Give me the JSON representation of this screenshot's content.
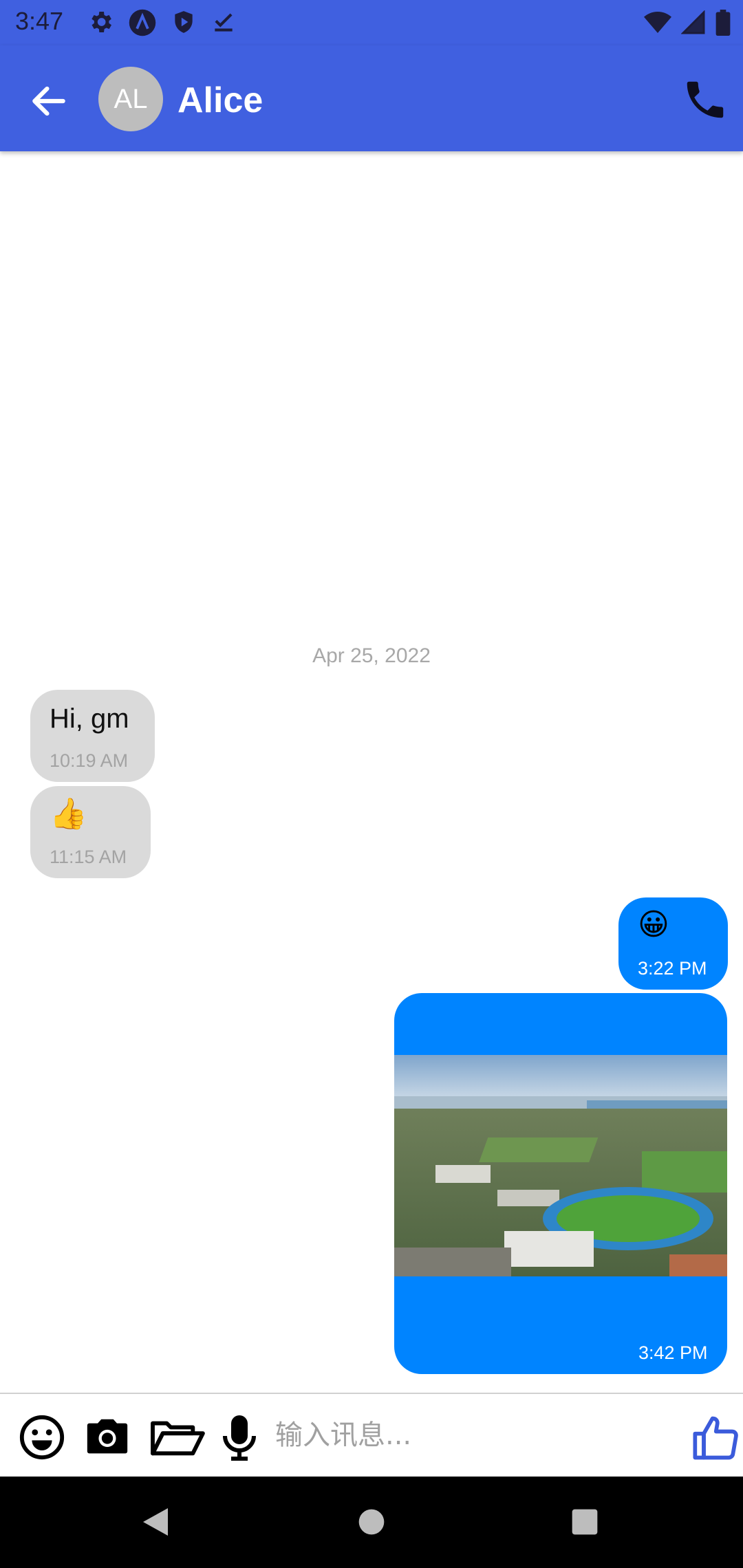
{
  "status_bar": {
    "time": "3:47",
    "icons": [
      "gear-icon",
      "android-studio-icon",
      "shield-play-icon",
      "download-done-icon"
    ],
    "right_icons": [
      "wifi-icon",
      "signal-icon",
      "battery-icon"
    ]
  },
  "header": {
    "avatar_initials": "AL",
    "contact_name": "Alice",
    "back_icon": "arrow-back-icon",
    "call_icon": "phone-icon"
  },
  "conversation": {
    "date_separator": "Apr 25, 2022",
    "messages": [
      {
        "direction": "incoming",
        "text": "Hi, gm",
        "time": "10:19 AM"
      },
      {
        "direction": "incoming",
        "text": "👍",
        "time": "11:15 AM"
      },
      {
        "direction": "outgoing",
        "text": "😀",
        "time": "3:22 PM"
      },
      {
        "direction": "outgoing",
        "image": "aerial-stadium-campus-photo",
        "time": "3:42 PM"
      }
    ]
  },
  "composer": {
    "placeholder": "输入讯息...",
    "tools": [
      "emoji-icon",
      "camera-icon",
      "folder-open-icon",
      "microphone-icon"
    ],
    "send_icon": "thumbs-up-icon"
  },
  "nav_bar": {
    "buttons": [
      "back-triangle",
      "home-circle",
      "recents-square"
    ]
  },
  "colors": {
    "header": "#4060E0",
    "outgoing_bubble": "#0084FF",
    "incoming_bubble": "#DADADA",
    "accent": "#3B5BDB"
  }
}
